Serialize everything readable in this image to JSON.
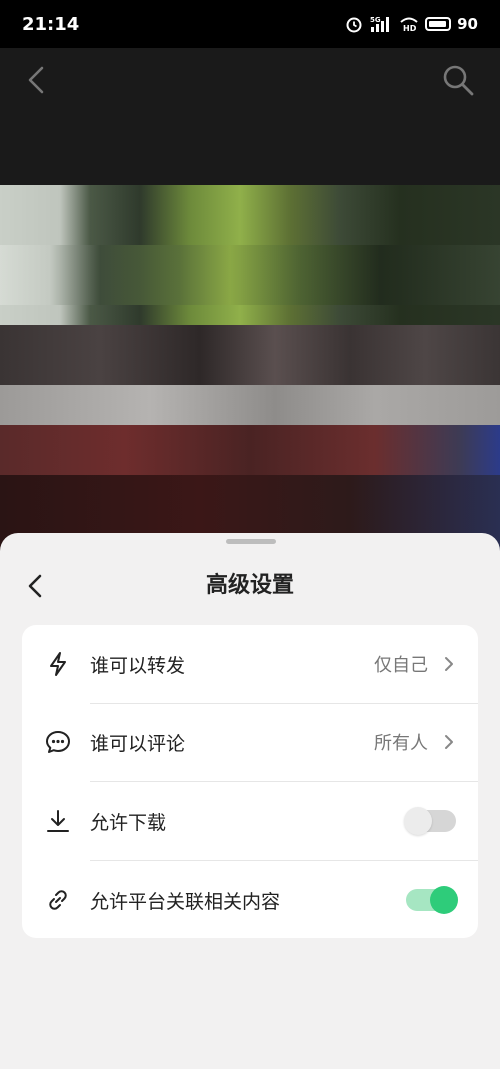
{
  "status_bar": {
    "time": "21:14",
    "network": "5G",
    "hd": "HD",
    "battery": "90"
  },
  "sheet": {
    "title": "高级设置"
  },
  "settings": [
    {
      "label": "谁可以转发",
      "value": "仅自己",
      "icon": "lightning-icon"
    },
    {
      "label": "谁可以评论",
      "value": "所有人",
      "icon": "comment-icon"
    },
    {
      "label": "允许下载",
      "toggle": false,
      "icon": "download-icon"
    },
    {
      "label": "允许平台关联相关内容",
      "toggle": true,
      "icon": "link-icon"
    }
  ],
  "colors": {
    "toggle_on": "#2ecc7a",
    "toggle_off": "#d6d6d6",
    "sheet_bg": "#f2f1f1"
  }
}
